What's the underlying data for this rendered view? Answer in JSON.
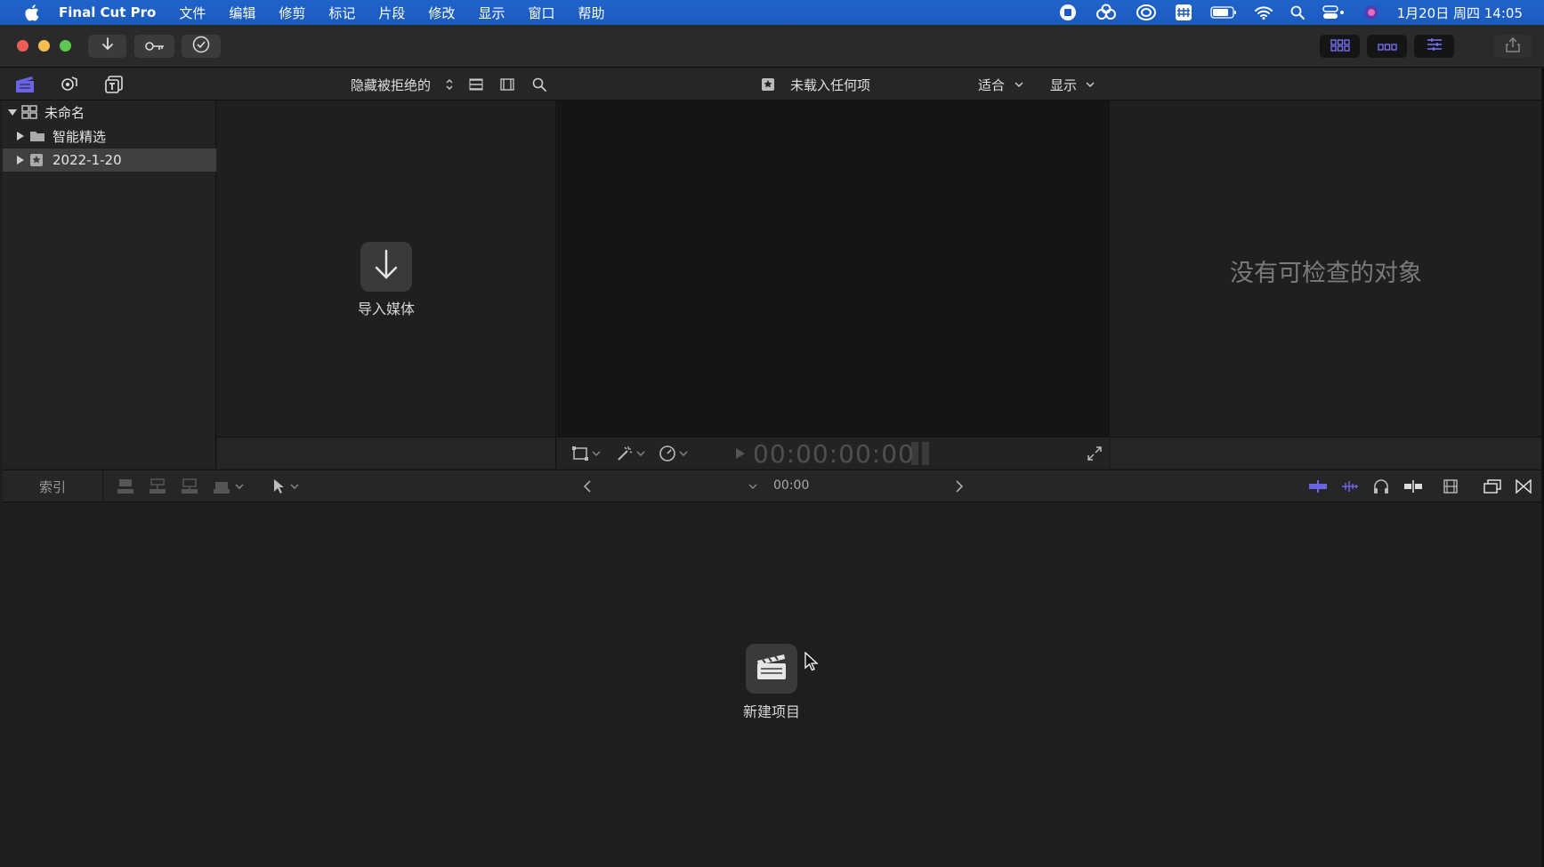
{
  "menubar": {
    "app_name": "Final Cut Pro",
    "items": [
      "文件",
      "编辑",
      "修剪",
      "标记",
      "片段",
      "修改",
      "显示",
      "窗口",
      "帮助"
    ],
    "clock": "1月20日 周四 14:05"
  },
  "browser_header": {
    "filter_label": "隐藏被拒绝的",
    "viewer_title": "未载入任何项",
    "fit_label": "适合",
    "display_label": "显示"
  },
  "sidebar": {
    "library_name": "未命名",
    "items": [
      {
        "label": "智能精选"
      },
      {
        "label": "2022-1-20"
      }
    ]
  },
  "browser": {
    "import_label": "导入媒体"
  },
  "viewer": {
    "timecode": "00:00:00:00"
  },
  "inspector": {
    "empty_message": "没有可检查的对象"
  },
  "timeline": {
    "index_label": "索引",
    "duration": "00:00",
    "new_project_label": "新建项目"
  },
  "colors": {
    "menubar": "#1b5bc0",
    "accent_purple": "#6b63e6"
  }
}
